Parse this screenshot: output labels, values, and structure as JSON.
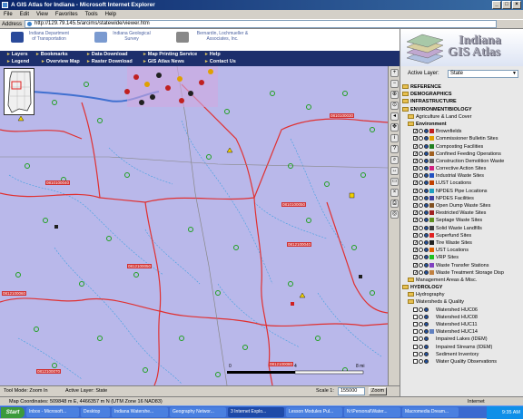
{
  "window": {
    "title": "A GIS Atlas for Indiana - Microsoft Internet Explorer",
    "min": "_",
    "max": "□",
    "close": "×"
  },
  "menu": [
    "File",
    "Edit",
    "View",
    "Favorites",
    "Tools",
    "Help"
  ],
  "address": {
    "label": "Address",
    "url": "http://129.79.145.5/arcims/statewide/viewer.htm"
  },
  "header": {
    "dnr": "Indiana Department of Transportation",
    "igs": "Indiana Geological Survey",
    "blr": "Bernardin, Lochmueller & Associates, Inc."
  },
  "nav": {
    "layers": "Layers",
    "bookmarks": "Bookmarks",
    "data_download": "Data Download",
    "map_printing": "Map Printing Service",
    "help": "Help",
    "legend": "Legend",
    "overview_map": "Overview Map",
    "raster_download": "Raster Download",
    "gis_atlas_news": "GIS Atlas News",
    "contact_us": "Contact Us"
  },
  "atlas": {
    "title_line1": "Indiana",
    "title_line2": "GIS Atlas"
  },
  "active_layer": {
    "label": "Active Layer:",
    "value": "State"
  },
  "tree": [
    {
      "kind": "folder",
      "bold": true,
      "label": "REFERENCE",
      "indent": 0
    },
    {
      "kind": "folder",
      "bold": true,
      "label": "DEMOGRAPHICS",
      "indent": 0
    },
    {
      "kind": "folder",
      "bold": true,
      "label": "INFRASTRUCTURE",
      "indent": 0
    },
    {
      "kind": "folder",
      "bold": true,
      "label": "ENVIRONMENT/BIOLOGY",
      "indent": 0
    },
    {
      "kind": "folder",
      "bold": false,
      "label": "Agriculture & Land Cover",
      "indent": 1
    },
    {
      "kind": "folder",
      "bold": true,
      "label": "Environment",
      "indent": 1
    },
    {
      "kind": "layer",
      "label": "Brownfields",
      "checked": true,
      "sym": "#c02020"
    },
    {
      "kind": "layer",
      "label": "Commissioner Bulletin Sites",
      "checked": true,
      "sym": "#e0a000"
    },
    {
      "kind": "layer",
      "label": "Composting Facilities",
      "checked": true,
      "sym": "#208020"
    },
    {
      "kind": "layer",
      "label": "Confined Feeding Operations",
      "checked": true,
      "sym": "#a06020"
    },
    {
      "kind": "layer",
      "label": "Construction Demolition Waste",
      "checked": true,
      "sym": "#606060"
    },
    {
      "kind": "layer",
      "label": "Corrective Action Sites",
      "checked": true,
      "sym": "#d02080"
    },
    {
      "kind": "layer",
      "label": "Industrial Waste Sites",
      "checked": true,
      "sym": "#2050c0"
    },
    {
      "kind": "layer",
      "label": "LUST Locations",
      "checked": true,
      "sym": "#c04000"
    },
    {
      "kind": "layer",
      "label": "NPDES Pipe Locations",
      "checked": true,
      "sym": "#20a0c0"
    },
    {
      "kind": "layer",
      "label": "NPDES Facilities",
      "checked": true,
      "sym": "#4040a0"
    },
    {
      "kind": "layer",
      "label": "Open Dump Waste Sites",
      "checked": true,
      "sym": "#805020"
    },
    {
      "kind": "layer",
      "label": "Restricted Waste Sites",
      "checked": true,
      "sym": "#a02020"
    },
    {
      "kind": "layer",
      "label": "Septage Waste Sites",
      "checked": true,
      "sym": "#609020"
    },
    {
      "kind": "layer",
      "label": "Solid Waste Landfills",
      "checked": true,
      "sym": "#404040"
    },
    {
      "kind": "layer",
      "label": "Superfund Sites",
      "checked": true,
      "sym": "#e02020"
    },
    {
      "kind": "layer",
      "label": "Tire Waste Sites",
      "checked": true,
      "sym": "#202020"
    },
    {
      "kind": "layer",
      "label": "UST Locations",
      "checked": true,
      "sym": "#e06000"
    },
    {
      "kind": "layer",
      "label": "VRP Sites",
      "checked": true,
      "sym": "#20c020"
    },
    {
      "kind": "layer",
      "label": "Waste Transfer Stations",
      "checked": true,
      "sym": "#8040c0"
    },
    {
      "kind": "layer",
      "label": "Waste Treatment Storage Disp",
      "checked": true,
      "sym": "#c08040"
    },
    {
      "kind": "folder",
      "bold": false,
      "label": "Management Areas & Misc.",
      "indent": 1
    },
    {
      "kind": "folder",
      "bold": true,
      "label": "HYDROLOGY",
      "indent": 0
    },
    {
      "kind": "folder",
      "bold": false,
      "label": "Hydrography",
      "indent": 1
    },
    {
      "kind": "folder",
      "bold": false,
      "label": "Watersheds & Quality",
      "indent": 1
    },
    {
      "kind": "layer",
      "label": "Watershed HUC06",
      "checked": false,
      "sym": ""
    },
    {
      "kind": "layer",
      "label": "Watershed HUC08",
      "checked": false,
      "sym": ""
    },
    {
      "kind": "layer",
      "label": "Watershed HUC11",
      "checked": false,
      "sym": ""
    },
    {
      "kind": "layer",
      "label": "Watershed HUC14",
      "checked": false,
      "sym": "#6080c0"
    },
    {
      "kind": "layer",
      "label": "Impaired Lakes (IDEM)",
      "checked": false,
      "sym": ""
    },
    {
      "kind": "layer",
      "label": "Impaired Streams (IDEM)",
      "checked": false,
      "sym": ""
    },
    {
      "kind": "layer",
      "label": "Sediment Inventory",
      "checked": false,
      "sym": ""
    },
    {
      "kind": "layer",
      "label": "Water Quality Observations",
      "checked": false,
      "sym": ""
    }
  ],
  "map": {
    "labels": [
      "0810100030",
      "0810100040",
      "0810100050",
      "0812100040",
      "0812100050",
      "0812100060",
      "0812100070",
      "0812100080",
      "0812100090"
    ],
    "scale_label": "Scale 1:",
    "scale_value": "155000",
    "zoom_label": "Zoom",
    "scale_bar_left": "0",
    "scale_bar_mid": "4",
    "scale_bar_right": "8 mi",
    "tool_mode": "Tool Mode: Zoom In",
    "active_layer": "Active Layer: State"
  },
  "ie_status": {
    "text": "Map Coordinates: 509848 m E, 4466357 m N (UTM Zone 16 NAD83)",
    "zone": "Internet"
  },
  "taskbar": {
    "start": "Start",
    "items": [
      "Inbox - Microsoft...",
      "Desktop",
      "Indiana Watershe...",
      "Geography Networ...",
      "3 Internet Explo...",
      "Lesson Modules Pul...",
      "N:\\Personal\\Water...",
      "Macromedia Dream..."
    ],
    "active_index": 4,
    "clock": "9:35 AM"
  }
}
